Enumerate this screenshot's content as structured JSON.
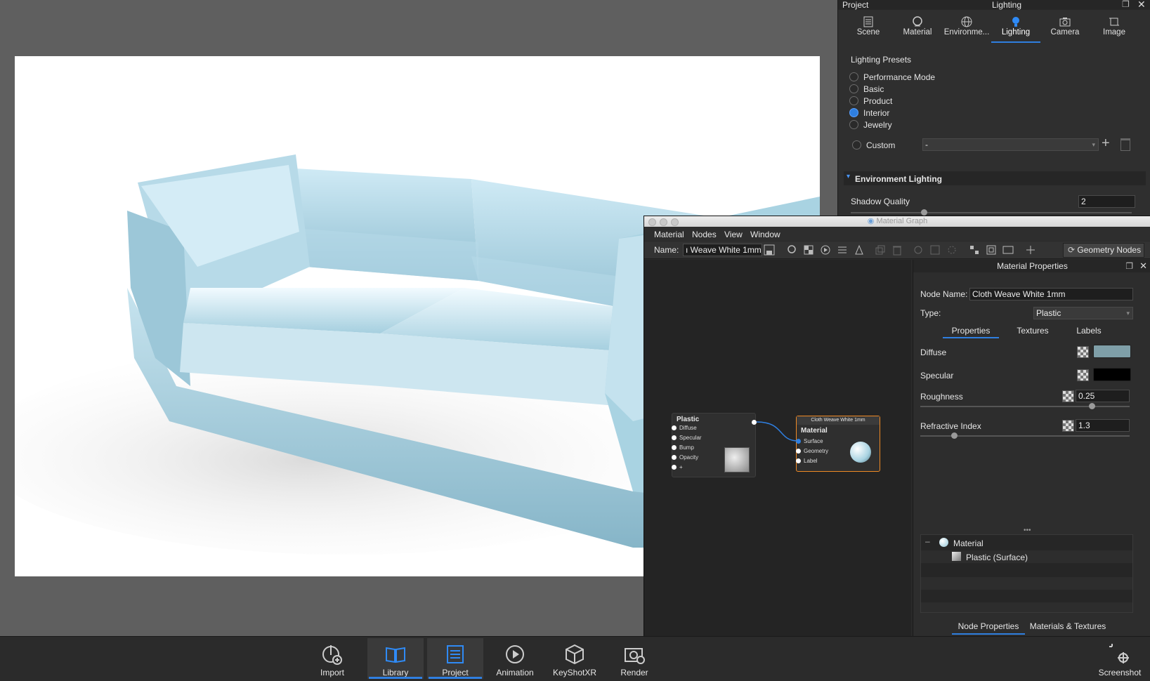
{
  "project_panel": {
    "title": "Project",
    "section_title": "Lighting",
    "tabs": [
      {
        "label": "Scene",
        "icon": "list-icon"
      },
      {
        "label": "Material",
        "icon": "material-ball-icon"
      },
      {
        "label": "Environme...",
        "icon": "globe-icon"
      },
      {
        "label": "Lighting",
        "icon": "light-bulb-icon"
      },
      {
        "label": "Camera",
        "icon": "camera-icon"
      },
      {
        "label": "Image",
        "icon": "crop-icon"
      }
    ],
    "active_tab": "Lighting",
    "presets_heading": "Lighting Presets",
    "presets": [
      "Performance Mode",
      "Basic",
      "Product",
      "Interior",
      "Jewelry"
    ],
    "selected_preset": "Interior",
    "custom_label": "Custom",
    "custom_value": "-",
    "env_lighting_heading": "Environment Lighting",
    "shadow_quality_label": "Shadow Quality",
    "shadow_quality_value": "2"
  },
  "material_graph": {
    "window_title": "Material Graph",
    "menu": [
      "Material",
      "Nodes",
      "View",
      "Window"
    ],
    "name_label": "Name:",
    "name_value": "ı Weave White 1mm",
    "geometry_nodes_label": "Geometry Nodes",
    "nodes": {
      "plastic": {
        "title": "Plastic",
        "ports": [
          "Diffuse",
          "Specular",
          "Bump",
          "Opacity",
          "+"
        ]
      },
      "material": {
        "header": "Cloth Weave White 1mm",
        "title": "Material",
        "ports": [
          "Surface",
          "Geometry",
          "Label"
        ]
      }
    }
  },
  "material_properties": {
    "title": "Material Properties",
    "node_name_label": "Node Name:",
    "node_name_value": "Cloth Weave White 1mm",
    "type_label": "Type:",
    "type_value": "Plastic",
    "tabs": [
      "Properties",
      "Textures",
      "Labels"
    ],
    "active_tab": "Properties",
    "diffuse_label": "Diffuse",
    "diffuse_color": "#7f9fa8",
    "specular_label": "Specular",
    "specular_color": "#000000",
    "roughness_label": "Roughness",
    "roughness_value": "0.25",
    "refractive_label": "Refractive Index",
    "refractive_value": "1.3",
    "tree": {
      "root": "Material",
      "child": "Plastic (Surface)"
    },
    "bottom_tabs": [
      "Node Properties",
      "Materials & Textures"
    ],
    "active_bottom_tab": "Node Properties"
  },
  "bottom_bar": {
    "items": [
      {
        "label": "Import",
        "icon": "import-icon"
      },
      {
        "label": "Library",
        "icon": "library-book-icon"
      },
      {
        "label": "Project",
        "icon": "project-list-icon"
      },
      {
        "label": "Animation",
        "icon": "animation-play-icon"
      },
      {
        "label": "KeyShotXR",
        "icon": "keyshotxr-cube-icon"
      },
      {
        "label": "Render",
        "icon": "render-camera-icon"
      }
    ],
    "active": [
      "Library",
      "Project"
    ],
    "screenshot_label": "Screenshot"
  },
  "colors": {
    "accent": "#2f7fe0",
    "sofa": "#a9d3e2",
    "node_highlight": "#f08a24"
  }
}
